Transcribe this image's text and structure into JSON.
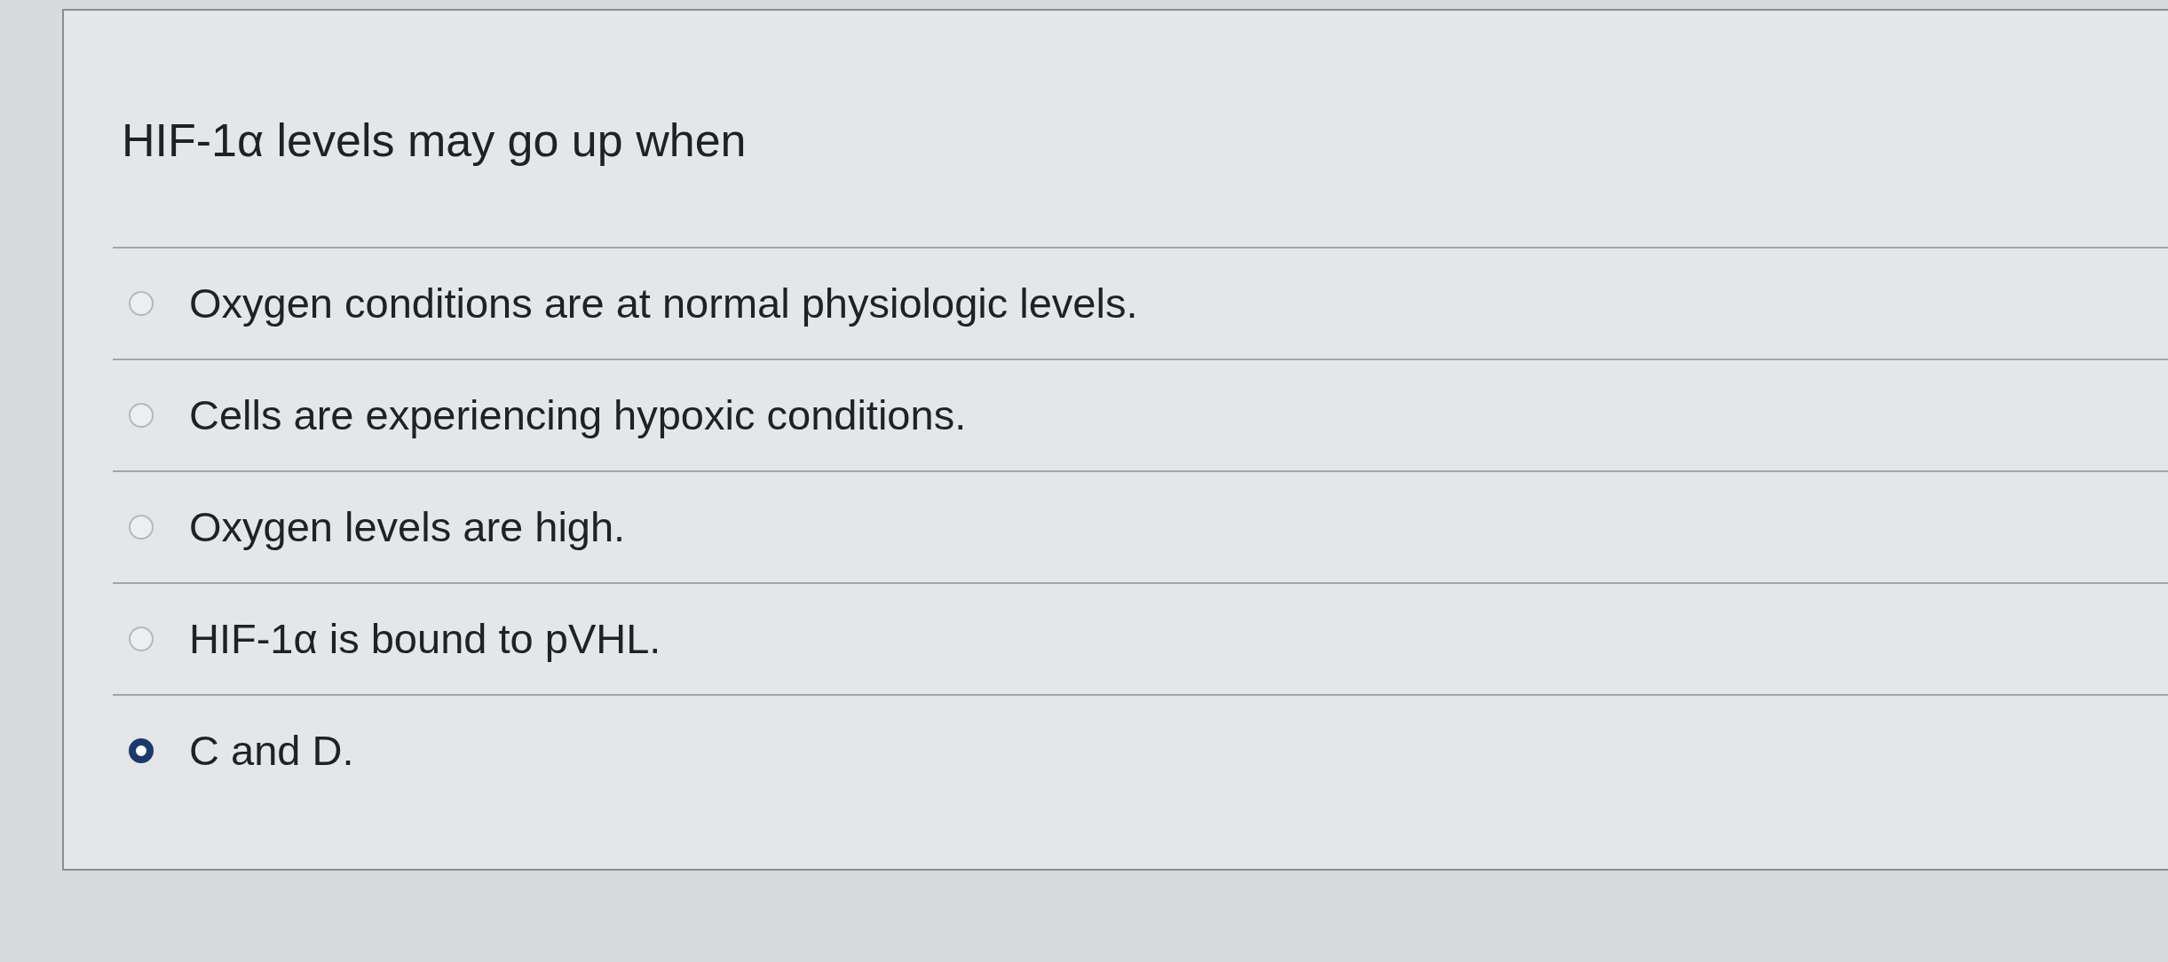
{
  "question": {
    "text": "HIF-1α levels may go up when"
  },
  "options": [
    {
      "label": "Oxygen conditions are at normal physiologic levels.",
      "selected": false
    },
    {
      "label": "Cells are experiencing hypoxic conditions.",
      "selected": false
    },
    {
      "label": "Oxygen levels are high.",
      "selected": false
    },
    {
      "label": "HIF-1α is bound to pVHL.",
      "selected": false
    },
    {
      "label": "C and D.",
      "selected": true
    }
  ]
}
